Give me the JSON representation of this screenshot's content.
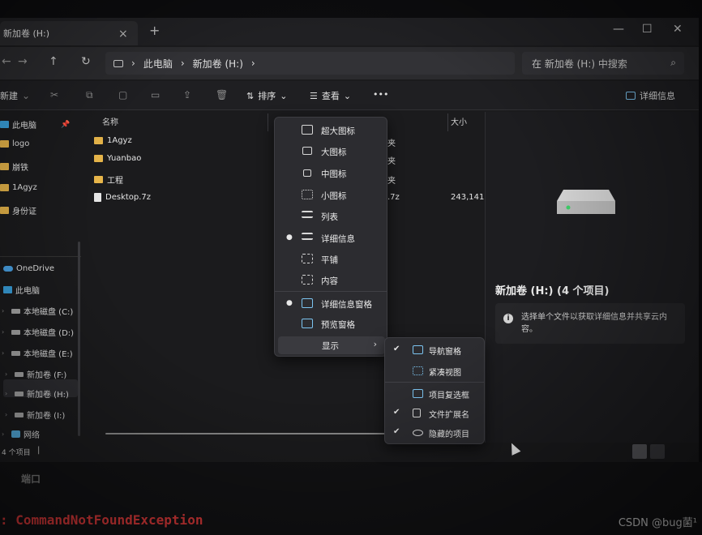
{
  "tab": {
    "title": "新加卷 (H:)",
    "close": "×",
    "new_tab": "+"
  },
  "window_controls": {
    "minimize": "—",
    "maximize": "☐",
    "close": "✕"
  },
  "nav": {
    "back": "←",
    "forward": "→",
    "up": "↑",
    "refresh": "↻"
  },
  "address": {
    "segments": [
      "此电脑",
      "新加卷 (H:)"
    ],
    "separator": "›"
  },
  "search": {
    "placeholder": "在 新加卷 (H:) 中搜索"
  },
  "commands": {
    "new": "新建",
    "sort": "排序",
    "view": "查看",
    "more": "•••",
    "details": "详细信息"
  },
  "sidebar": {
    "quick": [
      {
        "label": "此电脑",
        "type": "pc"
      },
      {
        "label": "logo",
        "type": "folder"
      },
      {
        "label": "崩铁",
        "type": "folder"
      },
      {
        "label": "1Agyz",
        "type": "folder"
      },
      {
        "label": "身份证",
        "type": "folder"
      }
    ],
    "tree": [
      {
        "label": "OneDrive",
        "type": "cloud"
      },
      {
        "label": "此电脑",
        "type": "pc"
      },
      {
        "label": "本地磁盘 (C:)",
        "type": "drive"
      },
      {
        "label": "本地磁盘 (D:)",
        "type": "drive"
      },
      {
        "label": "本地磁盘 (E:)",
        "type": "drive"
      },
      {
        "label": "新加卷 (F:)",
        "type": "drive"
      },
      {
        "label": "新加卷 (H:)",
        "type": "drive",
        "selected": true
      },
      {
        "label": "新加卷 (I:)",
        "type": "drive"
      },
      {
        "label": "网络",
        "type": "net"
      }
    ]
  },
  "file_list": {
    "columns": {
      "name": "名称",
      "size": "大小"
    },
    "files": [
      {
        "name": "1Agyz",
        "type": "folder",
        "partial": "夹",
        "size": ""
      },
      {
        "name": "Yuanbao",
        "type": "folder",
        "partial": "夹",
        "size": ""
      },
      {
        "name": "工程",
        "type": "folder",
        "partial": "夹",
        "size": ""
      },
      {
        "name": "Desktop.7z",
        "type": "file",
        "partial": ".7z",
        "size": "243,141"
      }
    ]
  },
  "view_menu": {
    "items": [
      {
        "label": "超大图标",
        "selected": false
      },
      {
        "label": "大图标",
        "selected": false
      },
      {
        "label": "中图标",
        "selected": false
      },
      {
        "label": "小图标",
        "selected": false
      },
      {
        "label": "列表",
        "selected": false
      },
      {
        "label": "详细信息",
        "selected": true
      },
      {
        "label": "平铺",
        "selected": false
      },
      {
        "label": "内容",
        "selected": false
      }
    ],
    "panes": [
      {
        "label": "详细信息窗格",
        "selected": true
      },
      {
        "label": "预览窗格",
        "selected": false
      }
    ],
    "show": {
      "label": "显示",
      "arrow": "›"
    }
  },
  "show_submenu": [
    {
      "label": "导航窗格",
      "checked": true
    },
    {
      "label": "紧凑视图",
      "checked": false
    },
    {
      "label": "项目复选框",
      "checked": false
    },
    {
      "label": "文件扩展名",
      "checked": true
    },
    {
      "label": "隐藏的项目",
      "checked": true
    }
  ],
  "details_pane": {
    "title": "新加卷 (H:) (4 个项目)",
    "info": "选择单个文件以获取详细信息并共享云内容。"
  },
  "status": {
    "count": "4 个项目"
  },
  "terminal": {
    "port_text": "端口",
    "error": ": CommandNotFoundException"
  },
  "watermark": "CSDN @bug菌¹"
}
